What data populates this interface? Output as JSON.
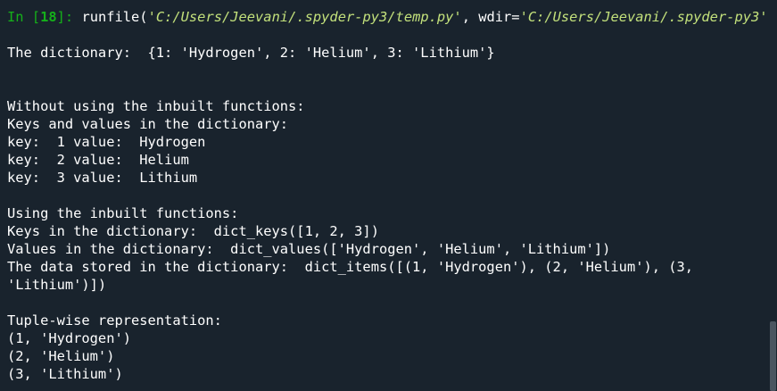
{
  "console": {
    "prompt": {
      "in_label": "In [",
      "number": "18",
      "close": "]: ",
      "call_start": "runfile(",
      "path": "'C:/Users/Jeevani/.spyder-py3/temp.py'",
      "sep": ", wdir=",
      "wdir": "'C:/Users/Jeevani/.spyder-py3'",
      "call_end": ")"
    },
    "output_lines": [
      "The dictionary:  {1: 'Hydrogen', 2: 'Helium', 3: 'Lithium'}",
      "",
      "",
      "Without using the inbuilt functions:",
      "Keys and values in the dictionary:",
      "key:  1 value:  Hydrogen",
      "key:  2 value:  Helium",
      "key:  3 value:  Lithium",
      "",
      "Using the inbuilt functions:",
      "Keys in the dictionary:  dict_keys([1, 2, 3])",
      "Values in the dictionary:  dict_values(['Hydrogen', 'Helium', 'Lithium'])",
      "The data stored in the dictionary:  dict_items([(1, 'Hydrogen'), (2, 'Helium'), (3,",
      "'Lithium')])",
      "",
      "Tuple-wise representation:",
      "(1, 'Hydrogen')",
      "(2, 'Helium')",
      "(3, 'Lithium')"
    ]
  },
  "colors": {
    "background": "#19232d",
    "prompt": "#15b01a",
    "string": "#c2e07b",
    "text": "#ffffff"
  }
}
